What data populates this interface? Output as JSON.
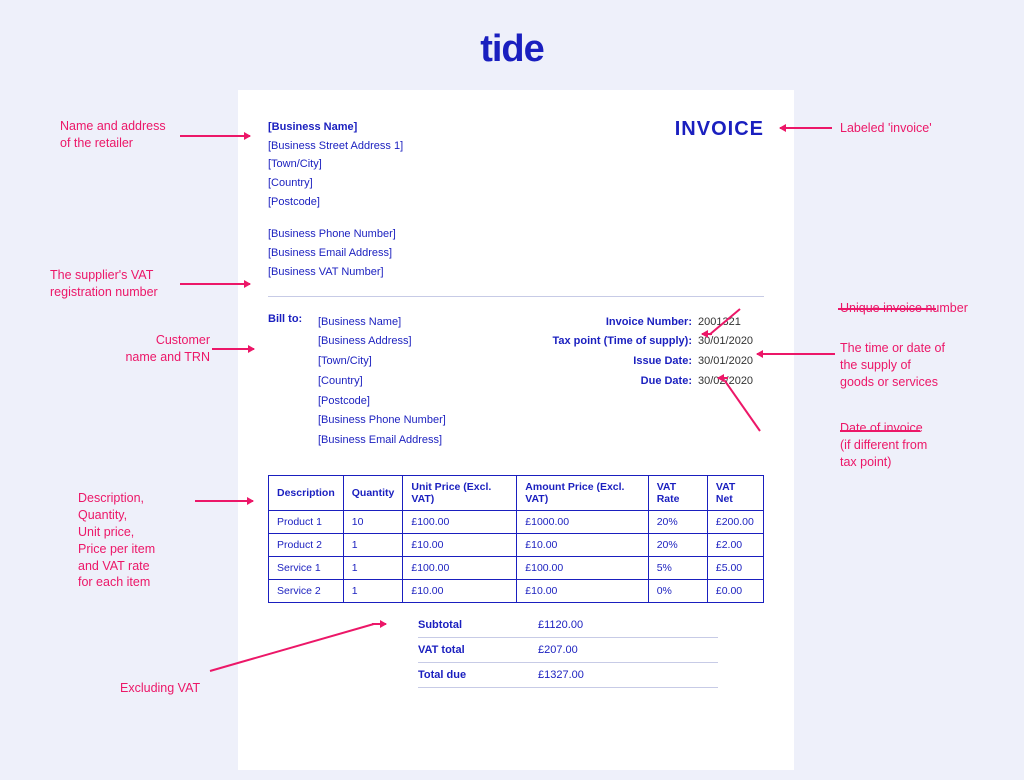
{
  "brand": {
    "logo_text": "tide"
  },
  "invoice": {
    "title": "INVOICE",
    "business": {
      "name": "[Business Name]",
      "address1": "[Business Street Address 1]",
      "town": "[Town/City]",
      "country": "[Country]",
      "postcode": "[Postcode]"
    },
    "contact": {
      "phone": "[Business Phone Number]",
      "email": "[Business Email Address]",
      "vat": "[Business VAT Number]"
    },
    "bill_to_label": "Bill to:",
    "bill_to": {
      "name": "[Business Name]",
      "address": "[Business Address]",
      "town": "[Town/City]",
      "country": "[Country]",
      "postcode": "[Postcode]",
      "phone": "[Business Phone Number]",
      "email": "[Business Email Address]"
    },
    "meta": {
      "invoice_number_label": "Invoice Number:",
      "invoice_number": "2001321",
      "tax_point_label": "Tax point (Time of supply):",
      "tax_point": "30/01/2020",
      "issue_date_label": "Issue Date:",
      "issue_date": "30/01/2020",
      "due_date_label": "Due Date:",
      "due_date": "30/02/2020"
    },
    "table": {
      "headers": {
        "desc": "Description",
        "qty": "Quantity",
        "unit": "Unit Price (Excl. VAT)",
        "amount": "Amount Price (Excl. VAT)",
        "rate": "VAT Rate",
        "net": "VAT Net"
      },
      "rows": [
        {
          "desc": "Product 1",
          "qty": "10",
          "unit": "£100.00",
          "amount": "£1000.00",
          "rate": "20%",
          "net": "£200.00"
        },
        {
          "desc": "Product 2",
          "qty": "1",
          "unit": "£10.00",
          "amount": "£10.00",
          "rate": "20%",
          "net": "£2.00"
        },
        {
          "desc": "Service 1",
          "qty": "1",
          "unit": "£100.00",
          "amount": "£100.00",
          "rate": "5%",
          "net": "£5.00"
        },
        {
          "desc": "Service 2",
          "qty": "1",
          "unit": "£10.00",
          "amount": "£10.00",
          "rate": "0%",
          "net": "£0.00"
        }
      ]
    },
    "totals": {
      "subtotal_label": "Subtotal",
      "subtotal": "£1120.00",
      "vat_total_label": "VAT total",
      "vat_total": "£207.00",
      "total_due_label": "Total due",
      "total_due": "£1327.00"
    }
  },
  "annotations": {
    "retailer": "Name and address\nof the retailer",
    "vat_reg": "The supplier's VAT\nregistration number",
    "customer": "Customer\nname and TRN",
    "line_items": "Description,\nQuantity,\nUnit price,\nPrice per item\nand VAT rate\nfor each item",
    "excl_vat": "Excluding VAT",
    "labeled_invoice": "Labeled 'invoice'",
    "unique_num": "Unique invoice number",
    "supply_date": "The time or date of\nthe supply of\ngoods or services",
    "invoice_date": "Date of invoice\n(if different from\ntax point)"
  }
}
